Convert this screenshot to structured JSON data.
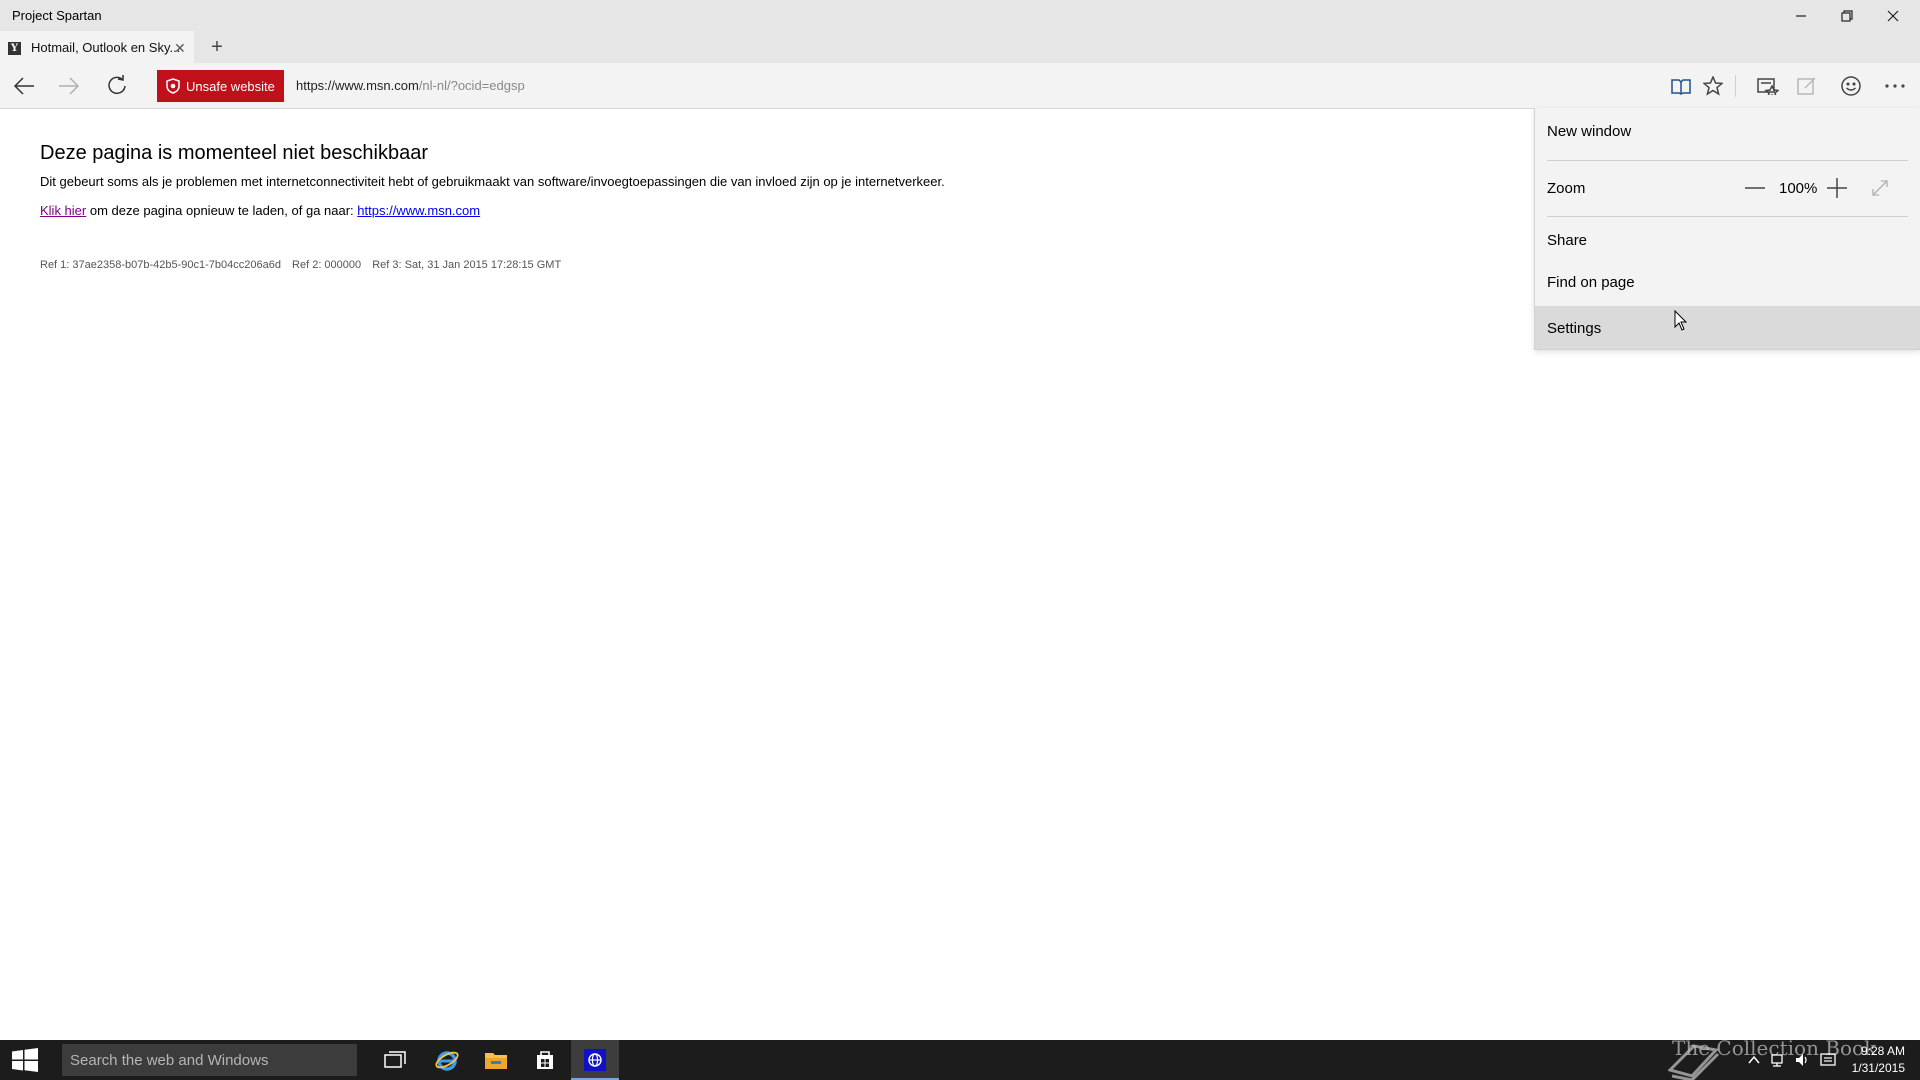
{
  "window": {
    "title": "Project Spartan",
    "minimize_icon": "minimize-icon",
    "restore_icon": "restore-icon",
    "close_icon": "close-icon"
  },
  "tabs": [
    {
      "title": "Hotmail, Outlook en Sky...",
      "active": true,
      "favicon": "msn-favicon",
      "favicon_letter": "Y"
    }
  ],
  "navbar": {
    "security_badge": "Unsafe website",
    "url_host": "https://www.msn.com",
    "url_path": "/nl-nl/?ocid=edgsp",
    "tools": [
      "reading-view-icon",
      "favorites-star-icon",
      "reading-list-icon",
      "web-note-icon",
      "feedback-smiley-icon",
      "more-actions-icon"
    ]
  },
  "page": {
    "heading": "Deze pagina is momenteel niet beschikbaar",
    "description": "Dit gebeurt soms als je problemen met internetconnectiviteit hebt of gebruikmaakt van software/invoegtoepassingen die van invloed zijn op je internetverkeer.",
    "retry_link": "Klik hier",
    "retry_text": " om deze pagina opnieuw te laden, of ga naar: ",
    "msn_link": "https://www.msn.com",
    "ref1": "Ref 1: 37ae2358-b07b-42b5-90c1-7b04cc206a6d",
    "ref2": "Ref 2: 000000",
    "ref3": "Ref 3: Sat, 31 Jan 2015 17:28:15 GMT"
  },
  "menu": {
    "new_window": "New window",
    "zoom_label": "Zoom",
    "zoom_value": "100%",
    "share": "Share",
    "find_on_page": "Find on page",
    "settings": "Settings",
    "hovered": "Settings"
  },
  "taskbar": {
    "search_placeholder": "Search the web and Windows",
    "apps": [
      "task-view-icon",
      "internet-explorer-icon",
      "file-explorer-icon",
      "store-icon",
      "spartan-browser-icon"
    ],
    "active_app": "spartan-browser-icon",
    "watermark": "The Collection Book",
    "time": "9:28 AM",
    "date": "1/31/2015"
  },
  "colors": {
    "unsafe_badge": "#c0101c",
    "taskbar": "#1c1c1c",
    "chrome": "#e6e6e6",
    "visited_link": "#800080",
    "link": "#0000ee"
  }
}
